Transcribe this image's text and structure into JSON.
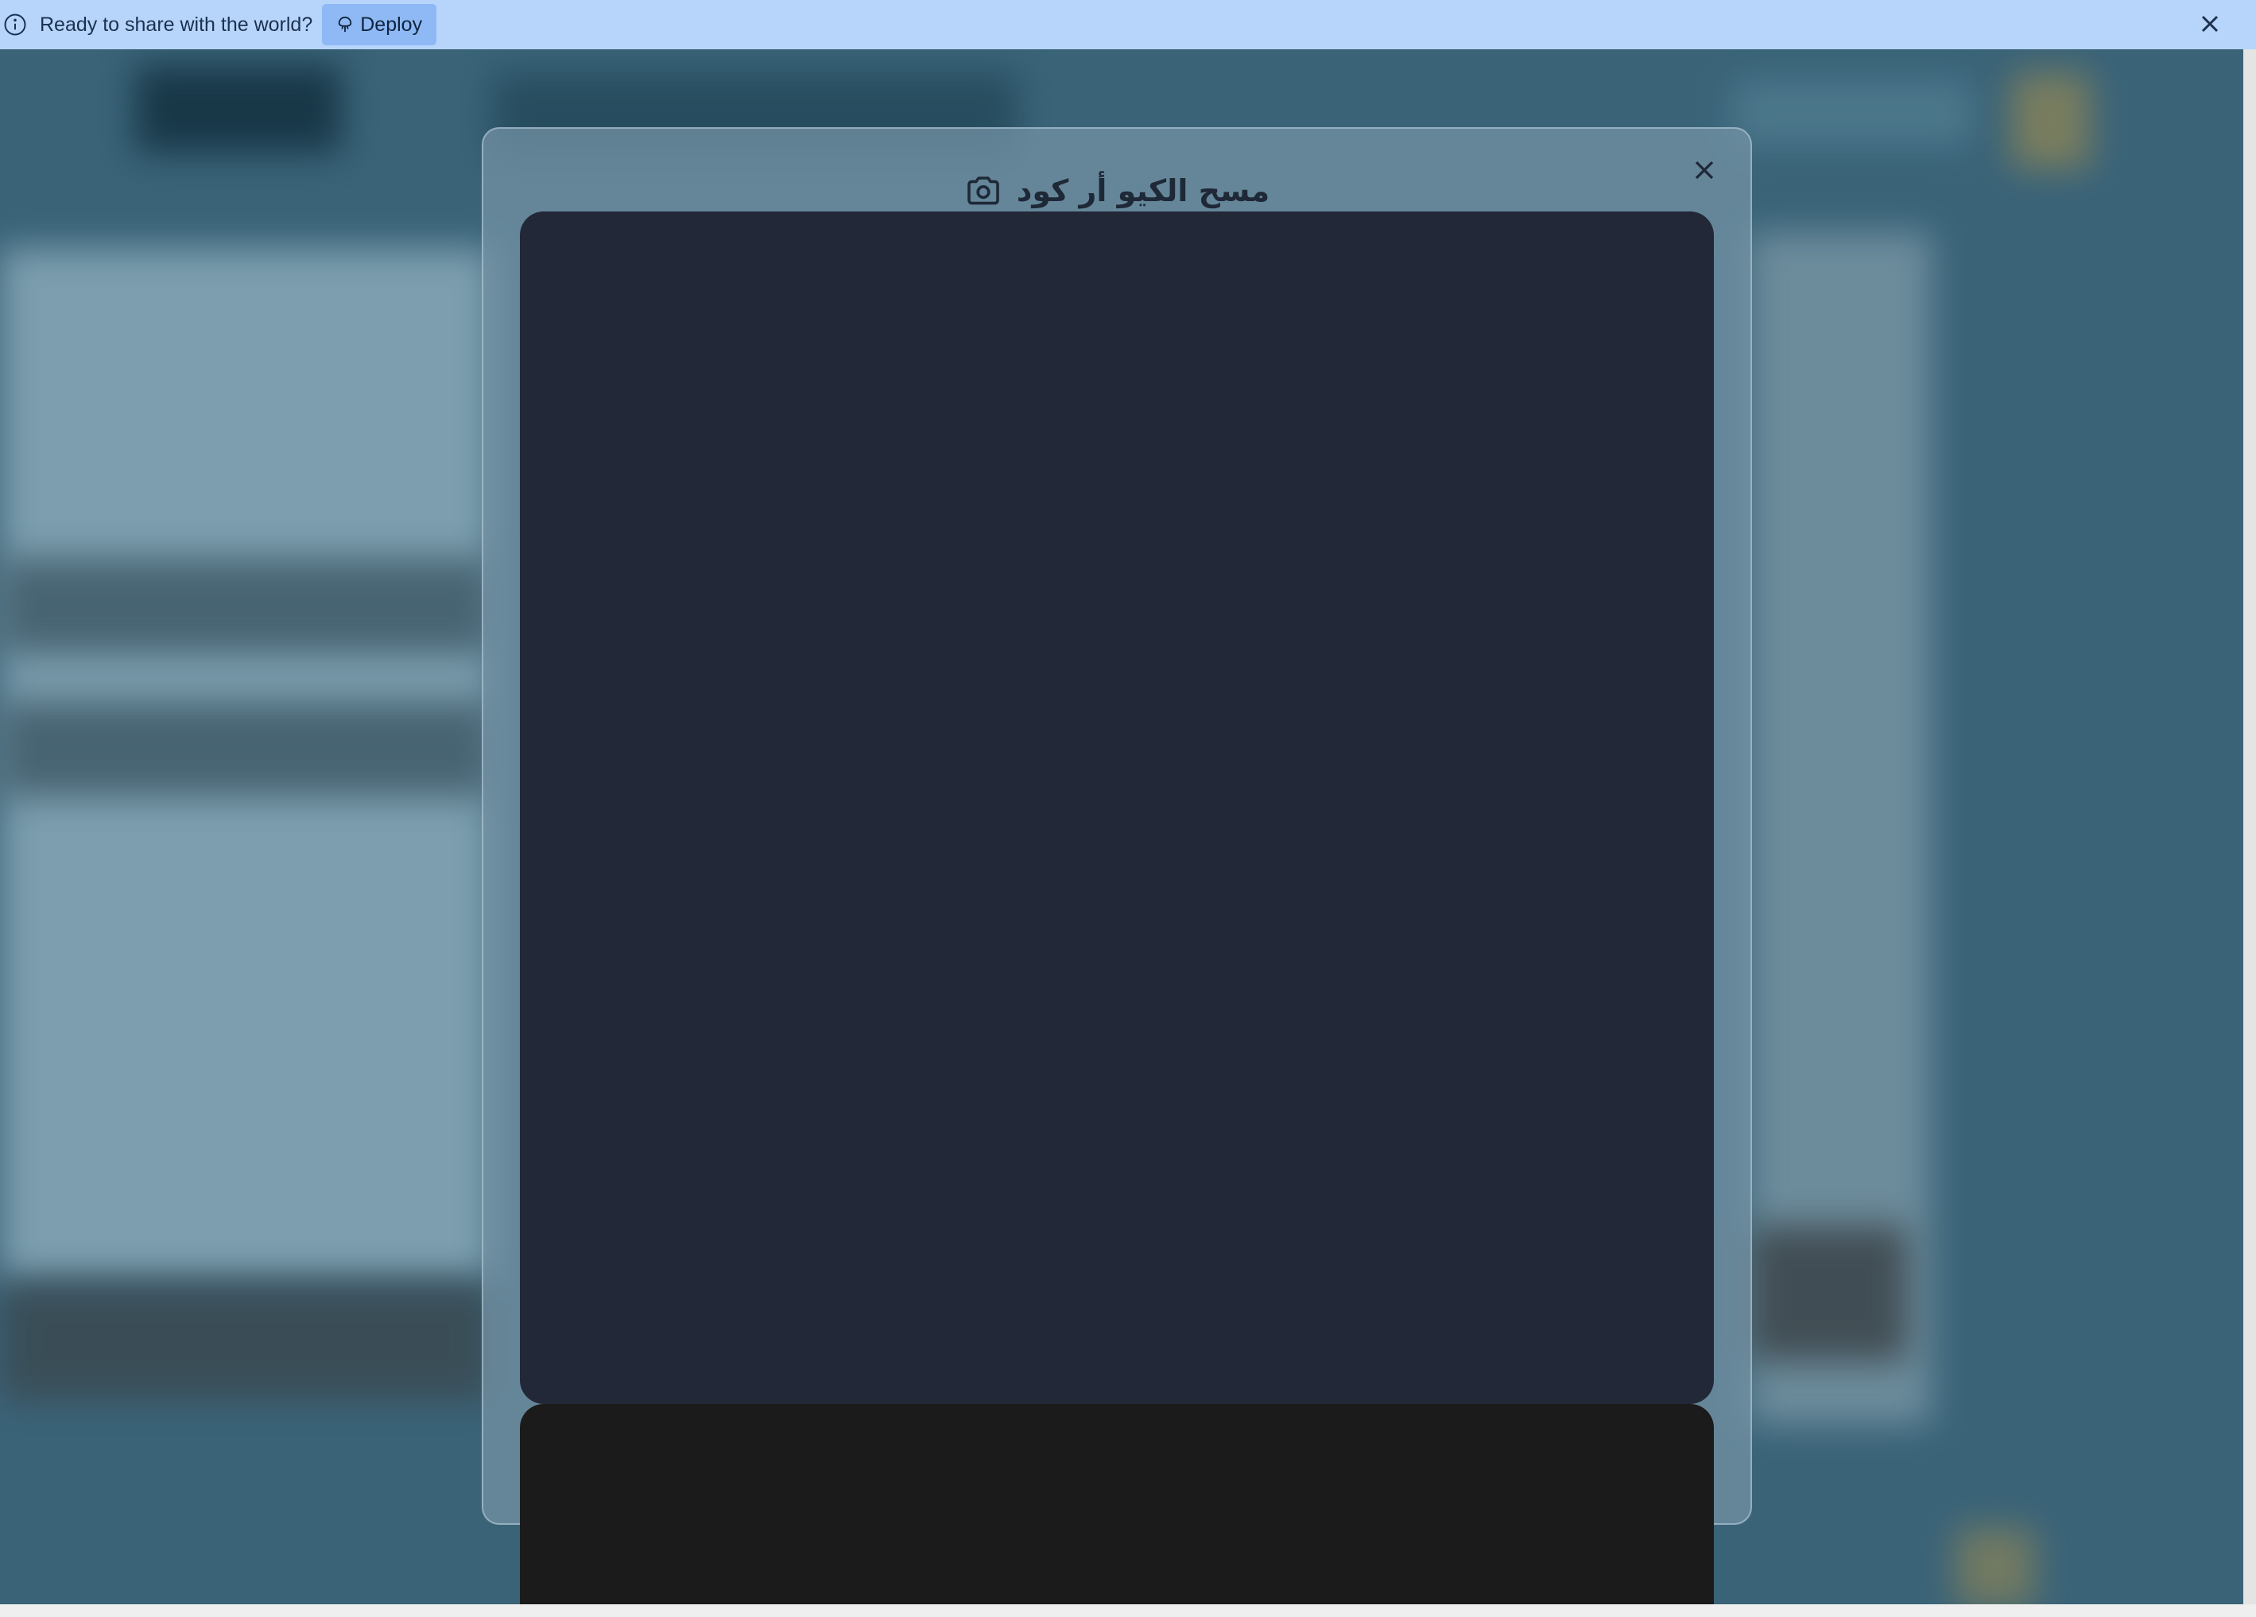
{
  "banner": {
    "message": "Ready to share with the world?",
    "deploy_label": "Deploy",
    "info_icon": "info-icon",
    "close_icon": "close-icon"
  },
  "modal": {
    "title": "مسح الكيو أر كود",
    "title_icon": "camera-icon",
    "close_icon": "close-icon"
  },
  "colors": {
    "banner_bg": "#b7d5fb",
    "deploy_bg": "#8fb9f5",
    "video_panel_bg": "#222837",
    "result_panel_bg": "#1b1b1b"
  }
}
